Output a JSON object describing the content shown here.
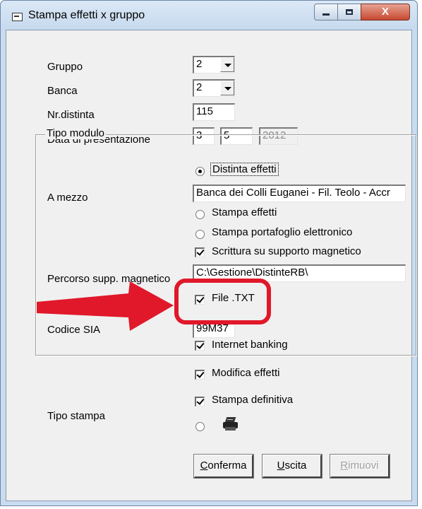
{
  "window": {
    "title": "Stampa effetti x gruppo",
    "controls": {
      "minimize": "minimize",
      "maximize": "maximize",
      "close": "X"
    }
  },
  "form": {
    "gruppo": {
      "label": "Gruppo",
      "value": "2"
    },
    "banca": {
      "label": "Banca",
      "value": "2"
    },
    "nr_distinta": {
      "label": "Nr.distinta",
      "value": "115"
    },
    "data_presentazione": {
      "label": "Data di presentazione",
      "day": "3",
      "month": "5",
      "year": "2012"
    }
  },
  "tipo_modulo": {
    "legend": "Tipo modulo",
    "radio_distinta": {
      "label": "Distinta effetti",
      "checked": true
    },
    "a_mezzo": {
      "label": "A mezzo",
      "value": "Banca dei Colli Euganei - Fil. Teolo - Accr"
    },
    "radio_stampa_effetti": {
      "label": "Stampa effetti",
      "checked": false
    },
    "radio_portafoglio": {
      "label": "Stampa portafoglio elettronico",
      "checked": false
    },
    "check_supporto": {
      "label": "Scrittura su supporto magnetico",
      "checked": true
    },
    "percorso": {
      "label": "Percorso supp. magnetico",
      "value": "C:\\Gestione\\DistinteRB\\"
    },
    "check_file_txt": {
      "label": "File .TXT",
      "checked": true
    },
    "codice_sia": {
      "label": "Codice SIA",
      "value": "99M37"
    },
    "check_internet": {
      "label": "Internet banking",
      "checked": true
    }
  },
  "options": {
    "check_modifica": {
      "label": "Modifica effetti",
      "checked": true
    },
    "check_definitiva": {
      "label": "Stampa definitiva",
      "checked": true
    },
    "tipo_stampa_label": "Tipo stampa",
    "printer_icon": "printer-icon"
  },
  "buttons": {
    "conferma": {
      "first": "C",
      "rest": "onferma"
    },
    "uscita": {
      "first": "U",
      "rest": "scita"
    },
    "rimuovi": {
      "first": "R",
      "rest": "imuovi"
    }
  },
  "annotation": {
    "arrow_color": "#e0182a",
    "highlight": "File .TXT"
  }
}
